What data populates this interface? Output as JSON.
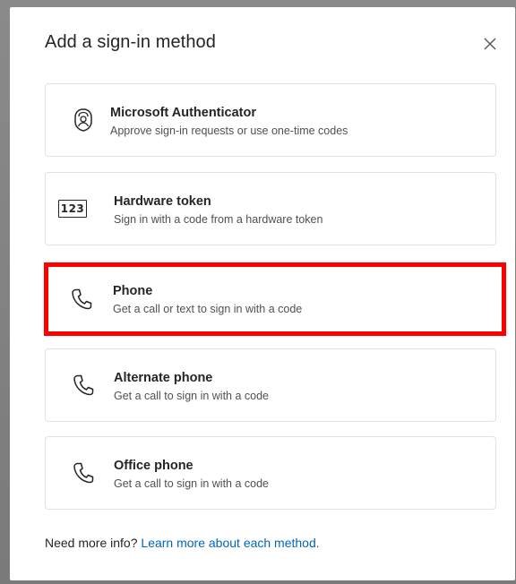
{
  "dialog": {
    "title": "Add a sign-in method",
    "close_icon": "close-icon"
  },
  "methods": [
    {
      "name": "Microsoft Authenticator",
      "description": "Approve sign-in requests or use one-time codes",
      "icon": "authenticator-lock-icon"
    },
    {
      "name": "Hardware token",
      "description": "Sign in with a code from a hardware token",
      "icon": "hardware-token-icon",
      "icon_text": "123"
    },
    {
      "name": "Phone",
      "description": "Get a call or text to sign in with a code",
      "icon": "phone-icon",
      "highlighted": true
    },
    {
      "name": "Alternate phone",
      "description": "Get a call to sign in with a code",
      "icon": "phone-icon"
    },
    {
      "name": "Office phone",
      "description": "Get a call to sign in with a code",
      "icon": "phone-icon"
    }
  ],
  "footer": {
    "text": "Need more info?",
    "link": "Learn more about each method."
  },
  "colors": {
    "link": "#0067b8",
    "highlight": "#ff0000",
    "text": "#252525",
    "secondary_text": "#505050",
    "border": "#e1e1e1"
  }
}
